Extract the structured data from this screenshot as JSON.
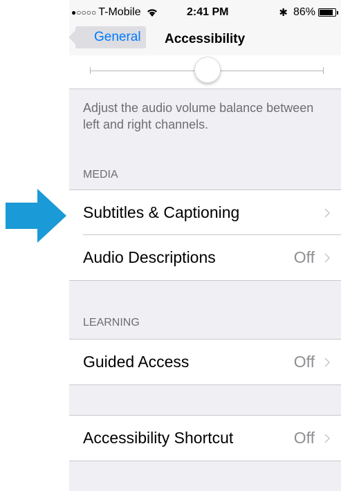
{
  "status_bar": {
    "signal_dots": "●○○○○",
    "carrier": "T-Mobile",
    "time": "2:41 PM",
    "bluetooth_icon": "bluetooth-icon",
    "battery_percent": "86%",
    "battery_level": 0.86
  },
  "nav": {
    "back_label": "General",
    "title": "Accessibility"
  },
  "balance_slider": {
    "value": 0.5
  },
  "balance_footer": "Adjust the audio volume balance between left and right channels.",
  "sections": {
    "media": {
      "header": "MEDIA",
      "items": [
        {
          "label": "Subtitles & Captioning",
          "value": ""
        },
        {
          "label": "Audio Descriptions",
          "value": "Off"
        }
      ]
    },
    "learning": {
      "header": "LEARNING",
      "items": [
        {
          "label": "Guided Access",
          "value": "Off"
        }
      ]
    },
    "shortcut": {
      "items": [
        {
          "label": "Accessibility Shortcut",
          "value": "Off"
        }
      ]
    }
  },
  "colors": {
    "accent": "#007aff",
    "annotation_arrow": "#1a9ad6",
    "background": "#efeff4"
  }
}
